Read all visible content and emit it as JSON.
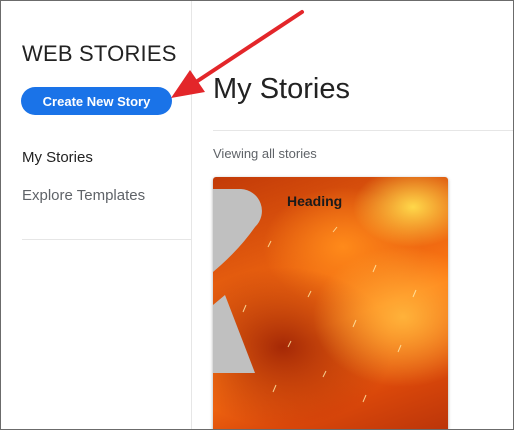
{
  "sidebar": {
    "brand": "WEB STORIES",
    "create_button": "Create New Story",
    "nav": [
      {
        "label": "My Stories",
        "active": true
      },
      {
        "label": "Explore Templates",
        "active": false
      }
    ]
  },
  "main": {
    "title": "My Stories",
    "filter_text": "Viewing all stories",
    "stories": [
      {
        "heading": "Heading"
      }
    ]
  },
  "colors": {
    "accent": "#1a73e8",
    "annotation_arrow": "#e3262a"
  }
}
